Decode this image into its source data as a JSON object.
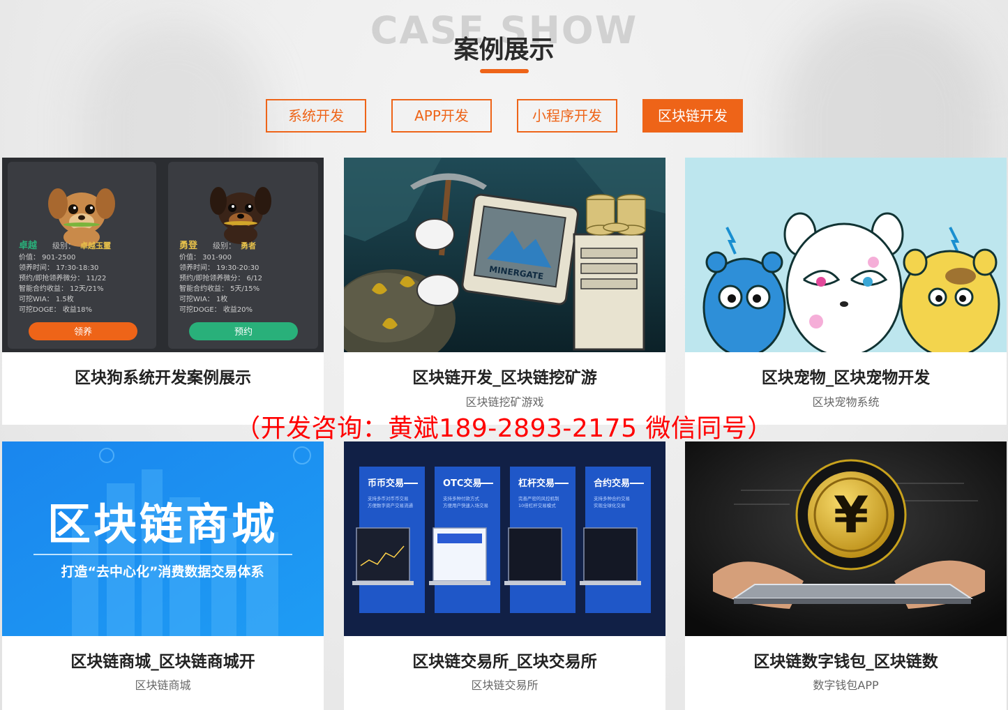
{
  "header": {
    "watermark": "CASE SHOW",
    "title": "案例展示"
  },
  "tabs": [
    {
      "label": "系统开发",
      "active": false
    },
    {
      "label": "APP开发",
      "active": false
    },
    {
      "label": "小程序开发",
      "active": false
    },
    {
      "label": "区块链开发",
      "active": true
    }
  ],
  "consult": "（开发咨询：黄斌189-2893-2175 微信同号）",
  "cards": [
    {
      "title": "区块狗系统开发案例展示",
      "subtitle": "",
      "image": {
        "pets": [
          {
            "name": "卓越",
            "level_label": "级别：",
            "level": "卓越玉璽",
            "stats": [
              "价值：  901-2500",
              "领养时间：  17:30-18:30",
              "预约/即抢领养微分：  11/22",
              "智能合约收益：  12天/21%",
              "可挖WIA：  1.5枚",
              "可挖DOGE：  收益18%"
            ],
            "button": "领养"
          },
          {
            "name": "勇登",
            "level_label": "级别：",
            "level": "勇者",
            "stats": [
              "价值：  301-900",
              "领养时间：  19:30-20:30",
              "预约/即抢领养微分：  6/12",
              "智能合约收益：  5天/15%",
              "可挖WIA：  1枚",
              "可挖DOGE：  收益20%"
            ],
            "button": "预约"
          }
        ]
      }
    },
    {
      "title": "区块链开发_区块链挖矿游",
      "subtitle": "区块链挖矿游戏",
      "image": {
        "brand": "MINERGATE"
      }
    },
    {
      "title": "区块宠物_区块宠物开发",
      "subtitle": "区块宠物系统",
      "image": {}
    },
    {
      "title": "区块链商城_区块链商城开",
      "subtitle": "区块链商城",
      "image": {
        "headline": "区块链商城",
        "tagline": "打造“去中心化”消费数据交易体系"
      }
    },
    {
      "title": "区块链交易所_区块交易所",
      "subtitle": "区块链交易所",
      "image": {
        "panels": [
          {
            "label": "币币交易",
            "lines": [
              "支持多币对币币交易",
              "方便数字资产交易流通"
            ]
          },
          {
            "label": "OTC交易",
            "lines": [
              "支持多种付款方式",
              "方便用户快速入场交易"
            ]
          },
          {
            "label": "杠杆交易",
            "lines": [
              "完善严密的风控机制",
              "10倍杠杆交易模式"
            ]
          },
          {
            "label": "合约交易",
            "lines": [
              "支持多种合约交易",
              "实现全球化交易"
            ]
          }
        ]
      }
    },
    {
      "title": "区块链数字钱包_区块链数",
      "subtitle": "数字钱包APP",
      "image": {
        "symbol": "¥"
      }
    }
  ],
  "colors": {
    "accent": "#ee6418",
    "consult": "#ff0000",
    "pet_card_bg": "#3a3c41",
    "pet_gold": "#e8c24a",
    "pet_green": "#29b07a",
    "mall_blue": "#1c8cf0",
    "exchange_navy": "#0f1b3d"
  }
}
